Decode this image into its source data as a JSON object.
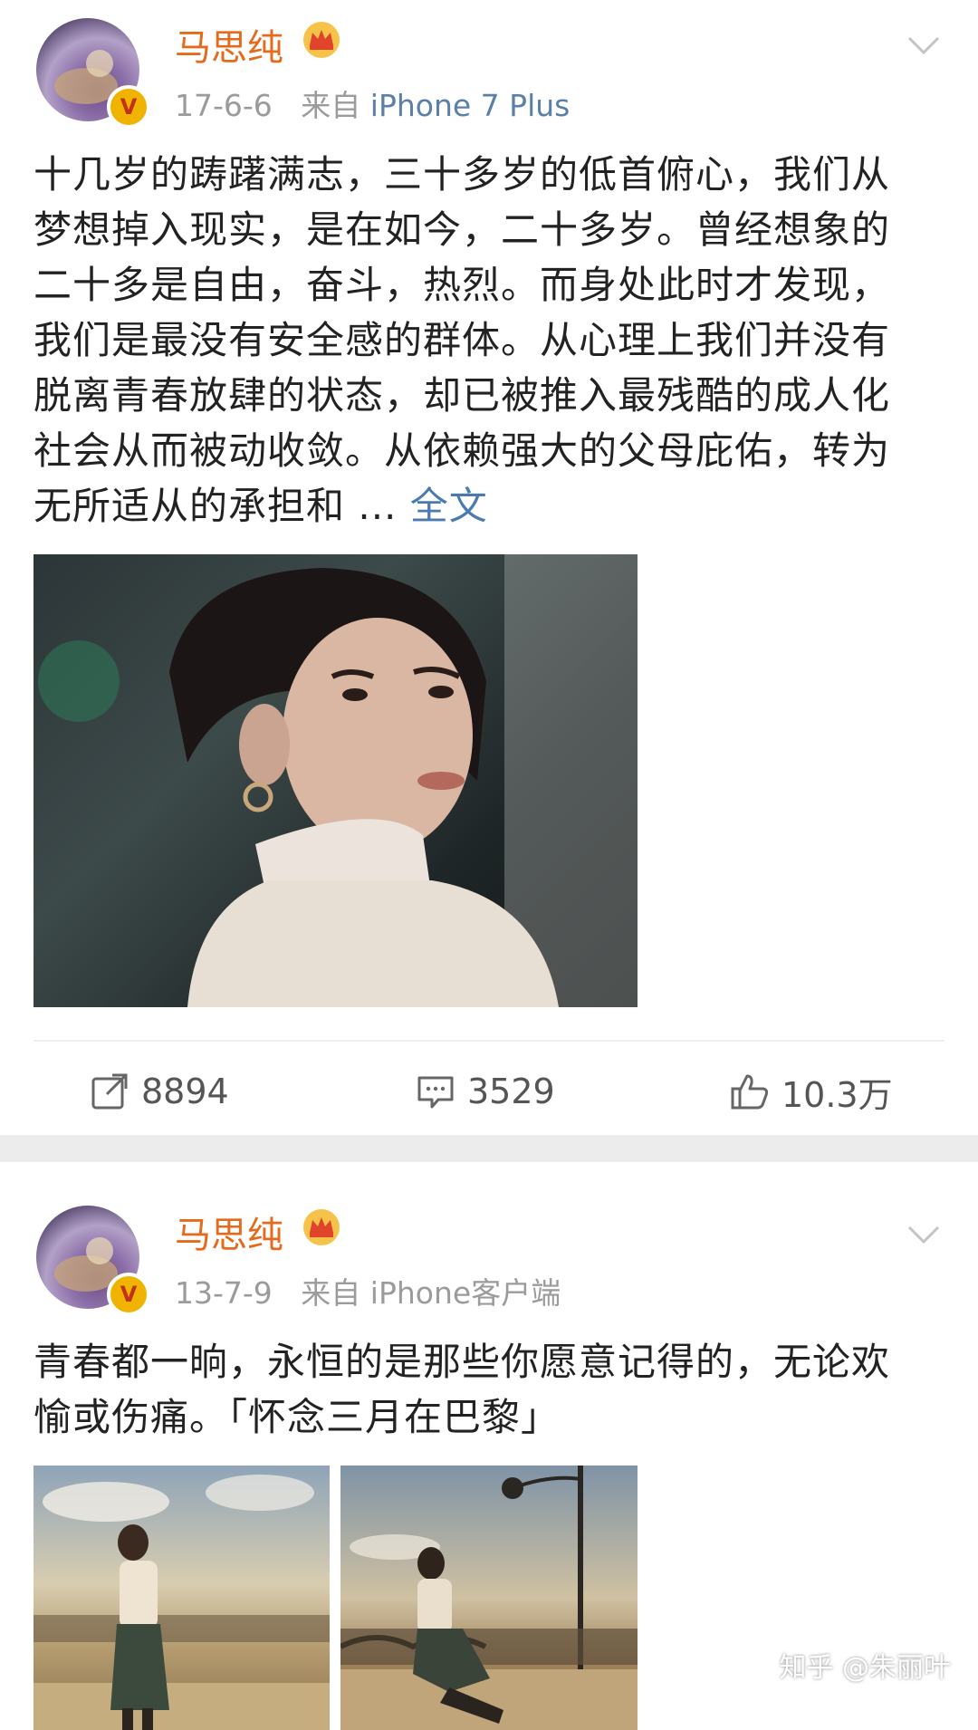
{
  "post1": {
    "username": "马思纯",
    "date": "17-6-6",
    "source_label": "来自",
    "device": "iPhone 7 Plus",
    "lines": [
      "十几岁的踌躇满志，三十多岁的低首俯心，我们从",
      "梦想掉入现实，是在如今，二十多岁。曾经想象的",
      "二十多是自由，奋斗，热烈。而身处此时才发现，",
      "我们是最没有安全感的群体。从心理上我们并没有",
      "脱离青春放肆的状态，却已被推入最残酷的成人化",
      "社会从而被动收敛。从依赖强大的父母庇佑，转为",
      "无所适从的承担和 ..."
    ],
    "full_text_link": "全文",
    "repost_count": "8894",
    "comment_count": "3529",
    "like_count": "10.3万"
  },
  "post2": {
    "username": "马思纯",
    "date": "13-7-9",
    "source_label": "来自",
    "device": "iPhone客户端",
    "lines": [
      "青春都一晌，永恒的是那些你愿意记得的，无论欢",
      "愉或伤痛。「怀念三月在巴黎」"
    ]
  },
  "watermark": "知乎 @朱丽叶",
  "icons": {
    "verified": "verified-v-badge-icon",
    "crown": "crown-icon",
    "chevron": "chevron-down-icon",
    "repost": "repost-icon",
    "comment": "comment-icon",
    "like": "thumbs-up-icon"
  },
  "colors": {
    "username": "#e56a1c",
    "link": "#4a7ab0",
    "meta": "#9b9b9b",
    "separator": "#ececec"
  }
}
